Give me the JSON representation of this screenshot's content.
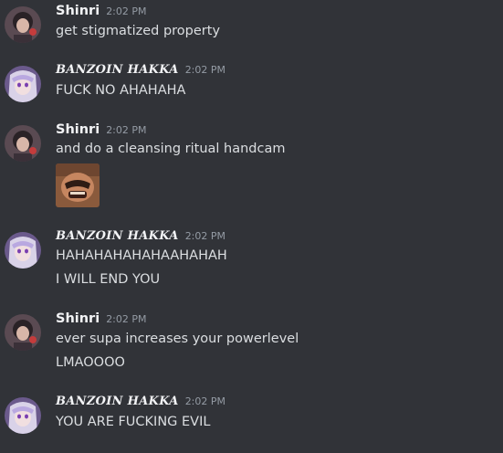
{
  "chat": {
    "messages": [
      {
        "author": "Shinri",
        "time": "2:02 PM",
        "lines": [
          "get stigmatized property"
        ]
      },
      {
        "author": "BANZOIN HAKKA",
        "time": "2:02 PM",
        "lines": [
          "FUCK NO AHAHAHA"
        ]
      },
      {
        "author": "Shinri",
        "time": "2:02 PM",
        "lines": [
          "and do a cleansing ritual handcam"
        ],
        "has_image": true
      },
      {
        "author": "BANZOIN HAKKA",
        "time": "2:02 PM",
        "lines": [
          "HAHAHAHAHAHAAHAHAH",
          "I WILL END YOU"
        ]
      },
      {
        "author": "Shinri",
        "time": "2:02 PM",
        "lines": [
          "ever supa increases your powerlevel",
          "LMAOOOO"
        ]
      },
      {
        "author": "BANZOIN HAKKA",
        "time": "2:02 PM",
        "lines": [
          "YOU ARE FUCKING EVIL"
        ]
      }
    ]
  },
  "colors": {
    "background": "#313338",
    "username": "#f2f3f5",
    "timestamp": "#949ba4",
    "text": "#dbdee1"
  }
}
